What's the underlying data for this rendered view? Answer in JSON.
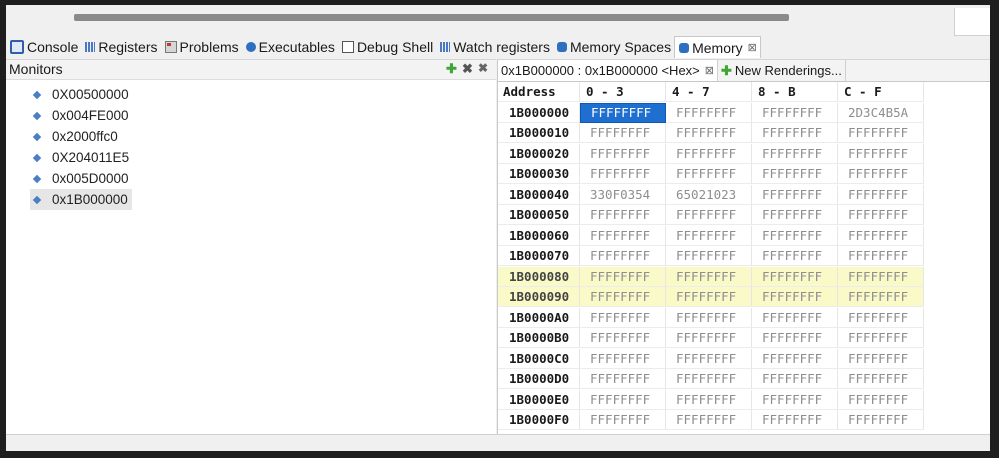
{
  "tabs": [
    {
      "label": "Console",
      "icon": "console-icon"
    },
    {
      "label": "Registers",
      "icon": "registers-icon"
    },
    {
      "label": "Problems",
      "icon": "problems-icon"
    },
    {
      "label": "Executables",
      "icon": "executables-icon"
    },
    {
      "label": "Debug Shell",
      "icon": "debug-shell-icon"
    },
    {
      "label": "Watch registers",
      "icon": "watch-registers-icon"
    },
    {
      "label": "Memory Spaces",
      "icon": "memory-spaces-icon"
    },
    {
      "label": "Memory",
      "icon": "memory-icon",
      "close": "⊠"
    }
  ],
  "monitors": {
    "title": "Monitors",
    "add": "✚",
    "remove": "✖",
    "remove_all": "✖",
    "items": [
      "0X00500000",
      "0x004FE000",
      "0x2000ffc0",
      "0X204011E5",
      "0x005D0000",
      "0x1B000000"
    ],
    "selected_index": 5
  },
  "rendering": {
    "tab_label": "0x1B000000 : 0x1B000000 <Hex>",
    "tab_close": "⊠",
    "new_tab_label": "New Renderings...",
    "new_tab_plus": "✚"
  },
  "memory": {
    "headers": [
      "Address",
      "0 - 3",
      "4 - 7",
      "8 - B",
      "C - F"
    ],
    "rows": [
      {
        "addr": "1B000000",
        "cells": [
          "FFFFFFFF",
          "FFFFFFFF",
          "FFFFFFFF",
          "2D3C4B5A"
        ]
      },
      {
        "addr": "1B000010",
        "cells": [
          "FFFFFFFF",
          "FFFFFFFF",
          "FFFFFFFF",
          "FFFFFFFF"
        ]
      },
      {
        "addr": "1B000020",
        "cells": [
          "FFFFFFFF",
          "FFFFFFFF",
          "FFFFFFFF",
          "FFFFFFFF"
        ]
      },
      {
        "addr": "1B000030",
        "cells": [
          "FFFFFFFF",
          "FFFFFFFF",
          "FFFFFFFF",
          "FFFFFFFF"
        ]
      },
      {
        "addr": "1B000040",
        "cells": [
          "330F0354",
          "65021023",
          "FFFFFFFF",
          "FFFFFFFF"
        ]
      },
      {
        "addr": "1B000050",
        "cells": [
          "FFFFFFFF",
          "FFFFFFFF",
          "FFFFFFFF",
          "FFFFFFFF"
        ]
      },
      {
        "addr": "1B000060",
        "cells": [
          "FFFFFFFF",
          "FFFFFFFF",
          "FFFFFFFF",
          "FFFFFFFF"
        ]
      },
      {
        "addr": "1B000070",
        "cells": [
          "FFFFFFFF",
          "FFFFFFFF",
          "FFFFFFFF",
          "FFFFFFFF"
        ]
      },
      {
        "addr": "1B000080",
        "cells": [
          "FFFFFFFF",
          "FFFFFFFF",
          "FFFFFFFF",
          "FFFFFFFF"
        ]
      },
      {
        "addr": "1B000090",
        "cells": [
          "FFFFFFFF",
          "FFFFFFFF",
          "FFFFFFFF",
          "FFFFFFFF"
        ]
      },
      {
        "addr": "1B0000A0",
        "cells": [
          "FFFFFFFF",
          "FFFFFFFF",
          "FFFFFFFF",
          "FFFFFFFF"
        ]
      },
      {
        "addr": "1B0000B0",
        "cells": [
          "FFFFFFFF",
          "FFFFFFFF",
          "FFFFFFFF",
          "FFFFFFFF"
        ]
      },
      {
        "addr": "1B0000C0",
        "cells": [
          "FFFFFFFF",
          "FFFFFFFF",
          "FFFFFFFF",
          "FFFFFFFF"
        ]
      },
      {
        "addr": "1B0000D0",
        "cells": [
          "FFFFFFFF",
          "FFFFFFFF",
          "FFFFFFFF",
          "FFFFFFFF"
        ]
      },
      {
        "addr": "1B0000E0",
        "cells": [
          "FFFFFFFF",
          "FFFFFFFF",
          "FFFFFFFF",
          "FFFFFFFF"
        ]
      },
      {
        "addr": "1B0000F0",
        "cells": [
          "FFFFFFFF",
          "FFFFFFFF",
          "FFFFFFFF",
          "FFFFFFFF"
        ]
      }
    ],
    "highlighted_rows": [
      8,
      9
    ],
    "selected_cell": {
      "row": 0,
      "col": 0
    }
  },
  "colors": {
    "selection": "#1f6fd0",
    "highlight": "#fafac8",
    "add_green": "#3fa535"
  }
}
